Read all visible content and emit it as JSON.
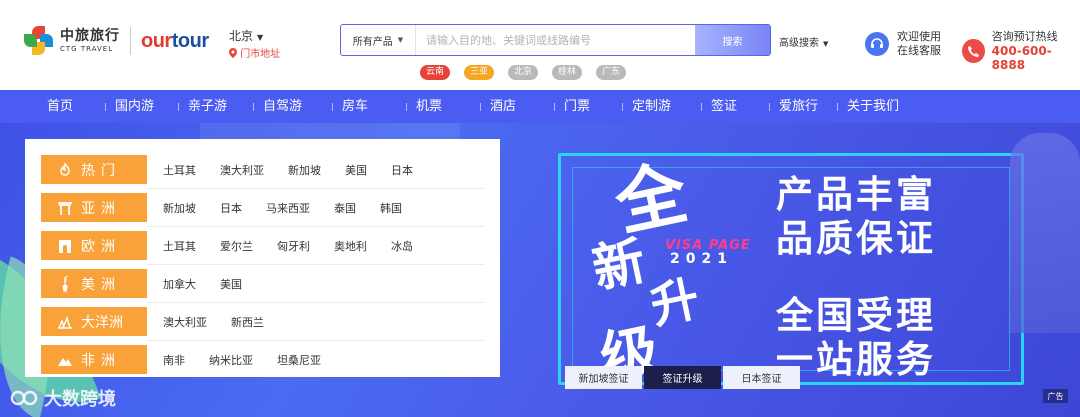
{
  "logo": {
    "cn": "中旅旅行",
    "en": "CTG TRAVEL",
    "brand_a": "our",
    "brand_b": "tour"
  },
  "location": {
    "city": "北京",
    "store_link": "门市地址"
  },
  "search": {
    "category": "所有产品",
    "placeholder": "请输入目的地、关键词或线路编号",
    "button": "搜索",
    "advanced": "高级搜索"
  },
  "hot_tags": [
    {
      "label": "云南",
      "color": "#e8433a"
    },
    {
      "label": "三亚",
      "color": "#f5a623"
    },
    {
      "label": "北京",
      "color": "#b9b9b9"
    },
    {
      "label": "桂林",
      "color": "#b9b9b9"
    },
    {
      "label": "广东",
      "color": "#b9b9b9"
    }
  ],
  "service": {
    "line1": "欢迎使用",
    "line2": "在线客服"
  },
  "hotline": {
    "label": "咨询预订热线",
    "number": "400-600-8888"
  },
  "nav": [
    "首页",
    "国内游",
    "亲子游",
    "自驾游",
    "房车",
    "机票",
    "酒店",
    "门票",
    "定制游",
    "签证",
    "爱旅行",
    "关于我们"
  ],
  "visa_regions": [
    {
      "label": "热门",
      "icon": "fire-icon",
      "countries": [
        "土耳其",
        "澳大利亚",
        "新加坡",
        "美国",
        "日本"
      ]
    },
    {
      "label": "亚洲",
      "icon": "torii-gate-icon",
      "countries": [
        "新加坡",
        "日本",
        "马来西亚",
        "泰国",
        "韩国"
      ]
    },
    {
      "label": "欧洲",
      "icon": "arc-de-triomphe-icon",
      "countries": [
        "土耳其",
        "爱尔兰",
        "匈牙利",
        "奥地利",
        "冰岛"
      ]
    },
    {
      "label": "美洲",
      "icon": "statue-of-liberty-icon",
      "countries": [
        "加拿大",
        "美国"
      ]
    },
    {
      "label": "大洋洲",
      "icon": "opera-house-icon",
      "countries": [
        "澳大利亚",
        "新西兰"
      ]
    },
    {
      "label": "非洲",
      "icon": "pyramid-icon",
      "countries": [
        "南非",
        "纳米比亚",
        "坦桑尼亚"
      ]
    }
  ],
  "promo": {
    "big_chars": [
      "全",
      "新",
      "升",
      "级"
    ],
    "visa_page": "VISA PAGE",
    "year": "2021",
    "slogan1": "产品丰富",
    "slogan2": "品质保证",
    "slogan3": "全国受理",
    "slogan4": "一站服务",
    "tabs": [
      "新加坡签证",
      "签证升级",
      "日本签证"
    ],
    "active_tab": "签证升级",
    "ad_label": "广告"
  },
  "watermark": "大数跨境"
}
